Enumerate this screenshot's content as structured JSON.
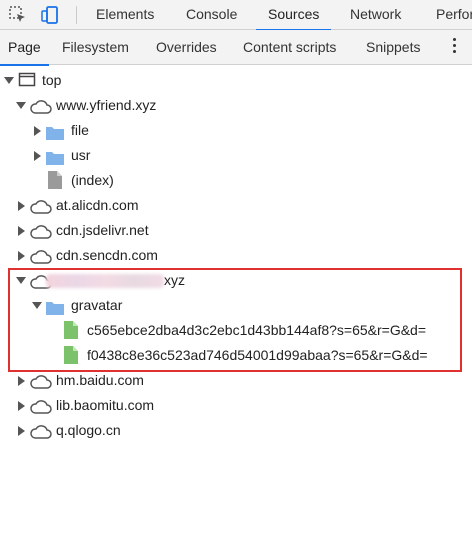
{
  "toolbar": {
    "tabs": [
      "Elements",
      "Console",
      "Sources",
      "Network",
      "Perfor"
    ],
    "active_tab": "Sources"
  },
  "subtabs": {
    "items": [
      "Page",
      "Filesystem",
      "Overrides",
      "Content scripts",
      "Snippets"
    ],
    "active": "Page"
  },
  "tree": {
    "top": "top",
    "domain1": "www.yfriend.xyz",
    "folder_file": "file",
    "folder_usr": "usr",
    "index": "(index)",
    "domain2": "at.alicdn.com",
    "domain3": "cdn.jsdelivr.net",
    "domain4": "cdn.sencdn.com",
    "domain5_suffix": "xyz",
    "folder_gravatar": "gravatar",
    "file1": "c565ebce2dba4d3c2ebc1d43bb144af8?s=65&r=G&d=",
    "file2": "f0438c8e36c523ad746d54001d99abaa?s=65&r=G&d=",
    "domain6": "hm.baidu.com",
    "domain7": "lib.baomitu.com",
    "domain8": "q.qlogo.cn"
  },
  "colors": {
    "accent": "#1a73e8",
    "folder": "#7fb3ea",
    "file_green": "#7cc26b",
    "highlight": "#e03030"
  }
}
